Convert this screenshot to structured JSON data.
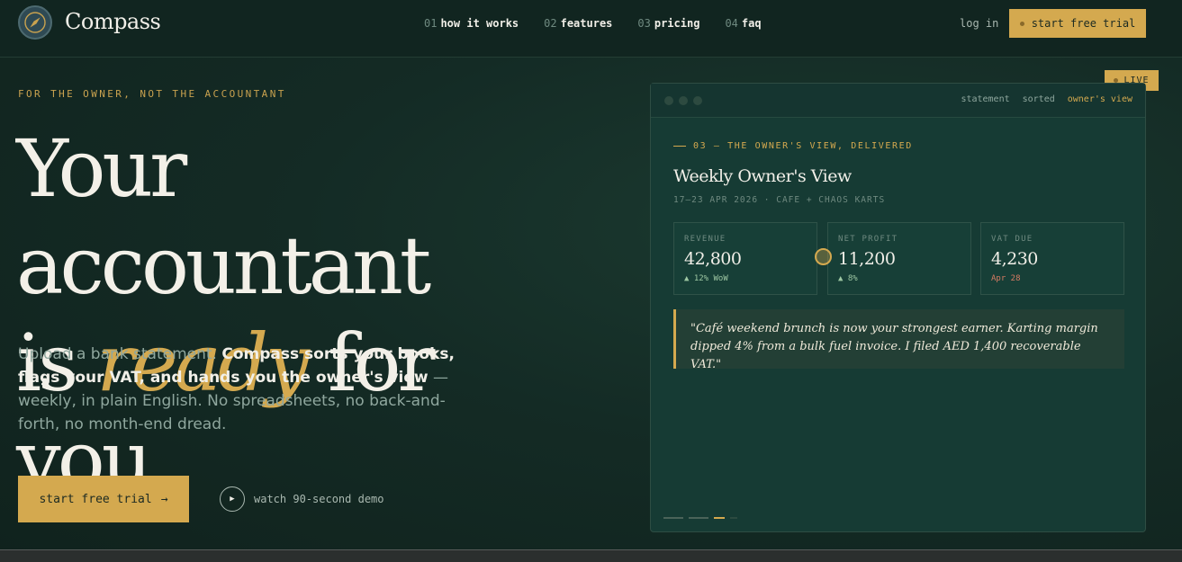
{
  "nav": {
    "brand": "Compass",
    "links": [
      {
        "num": "01",
        "label": "how it works"
      },
      {
        "num": "02",
        "label": "features"
      },
      {
        "num": "03",
        "label": "pricing"
      },
      {
        "num": "04",
        "label": "faq"
      }
    ],
    "login": "log in",
    "cta": "start free trial"
  },
  "hero": {
    "eyebrow": "FOR THE OWNER, NOT THE ACCOUNTANT",
    "headline_line1": "Your accountant",
    "headline_pre": "is",
    "headline_accent": "ready",
    "headline_post": "for you.",
    "sub_plain1": "Upload a bank statement.",
    "sub_bold": "Compass sorts your books, flags your VAT, and hands you the owner's view",
    "sub_plain2": "— weekly, in plain English. No spreadsheets, no back-and-forth, no month-end dread.",
    "cta": "start free trial",
    "cta_arrow": "→",
    "demo": "watch 90-second demo"
  },
  "card": {
    "live": "LIVE",
    "tabs": [
      "statement",
      "sorted",
      "owner's view"
    ],
    "section": "03 — THE OWNER'S VIEW, DELIVERED",
    "title": "Weekly Owner's View",
    "meta": "17–23 APR 2026 · CAFE + CHAOS KARTS",
    "stats": [
      {
        "label": "REVENUE",
        "value": "42,800",
        "delta": "▲ 12% WoW"
      },
      {
        "label": "NET PROFIT",
        "value": "11,200",
        "delta": "▲ 8%"
      },
      {
        "label": "VAT DUE",
        "value": "4,230",
        "delta": "Apr 28"
      }
    ],
    "quote": "\"Café weekend brunch is now your strongest earner. Karting margin dipped 4% from a bulk fuel invoice. I filed AED 1,400 recoverable VAT.\""
  },
  "colors": {
    "accent": "#d4a94f",
    "background": "#142b25",
    "negative": "#d77b63",
    "positive": "#9ec7a3"
  }
}
